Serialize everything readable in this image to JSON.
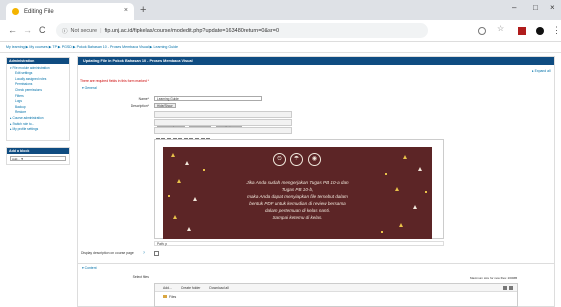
{
  "browser": {
    "tab_title": "Editing File",
    "tab_close": "×",
    "new_tab": "+",
    "minimize": "–",
    "maximize": "□",
    "close": "×",
    "back": "←",
    "forward": "→",
    "reload": "C",
    "info": "ⓘ",
    "not_secure": "Not secure",
    "separator": "|",
    "url": "fip.unj.ac.id/fipkelas/course/modedit.php?update=163480return=0&sr=0",
    "menu": "⋮"
  },
  "breadcrumb": "My learning ▶ My courses ▶ TP ▶ PGSD ▶ Pokok Bahasan 10 - Proses Membaca Visual ▶ Learning Guide",
  "admin_block": {
    "title": "Administration",
    "items": [
      "▾ File module administration",
      "Edit settings",
      "Locally assigned roles",
      "Permissions",
      "Check permissions",
      "Filters",
      "Logs",
      "Backup",
      "Restore",
      "▸ Course administration",
      "▸ Switch role to...",
      "▸ My profile settings"
    ]
  },
  "add_block": {
    "title": "Add a block",
    "select": "Add...  ▼"
  },
  "main": {
    "header": "Updating File in Pokok Bahasan 10 - Proses Membaca Visual",
    "expand_all": "▸ Expand all",
    "required_note": "There are required fields in this form marked *",
    "general_section": "▾ General",
    "name_label": "Name*",
    "name_value": "Learning Guide",
    "description_label": "Description*",
    "description_button": "Hide/Show",
    "font_family": "Font family",
    "font_size": "Font size",
    "paragraph": "Paragraph",
    "path_label": "Path: p",
    "display_label": "Display description on course page",
    "help_icon": "?",
    "content_section": "▾ Content",
    "select_files_label": "Select files",
    "max_size": "Maximum size for new files: 200MB",
    "fp_add": "Add...",
    "fp_create": "Create folder",
    "fp_download": "Download all",
    "fp_files": "Files"
  },
  "banner": {
    "icon1": "⏲",
    "icon2": "☂",
    "icon3": "◉",
    "lines": [
      "Jika Anda sudah mengerjakan Tugas PB 10-a dan",
      "Tugas PB 10-b,",
      "maka Anda dapat menyiapkan file tersebut dalam",
      "bentuk PDF untuk kemudian di review bersama",
      "dalam pertemuan di kelas nanti.",
      "Sampai ketemu di kelas."
    ],
    "bg_color": "#5c2526",
    "text_color": "#f1e8dc",
    "accent_color": "#e9c24a"
  }
}
